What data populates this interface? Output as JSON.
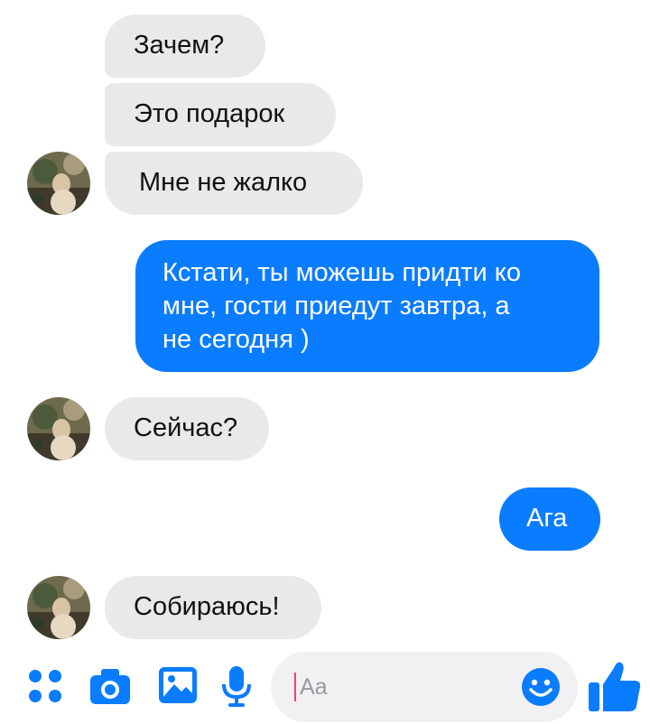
{
  "messages": {
    "m1": "Зачем?",
    "m2": "Это подарок",
    "m3": "Мне не жалко",
    "m4_line1": "Кстати, ты можешь придти ко",
    "m4_line2": "мне, гости приедут завтра, а",
    "m4_line3": "не сегодня )",
    "m5": "Сейчас?",
    "m6": "Ага",
    "m7": "Собираюсь!"
  },
  "composer": {
    "placeholder": "Aa",
    "icons": [
      "more-apps-icon",
      "camera-icon",
      "gallery-icon",
      "microphone-icon",
      "emoji-icon",
      "thumbs-up-icon"
    ]
  },
  "colors": {
    "outgoing_bubble": "#0a7cff",
    "incoming_bubble": "#e9e9eb",
    "accent": "#0a7cff"
  }
}
